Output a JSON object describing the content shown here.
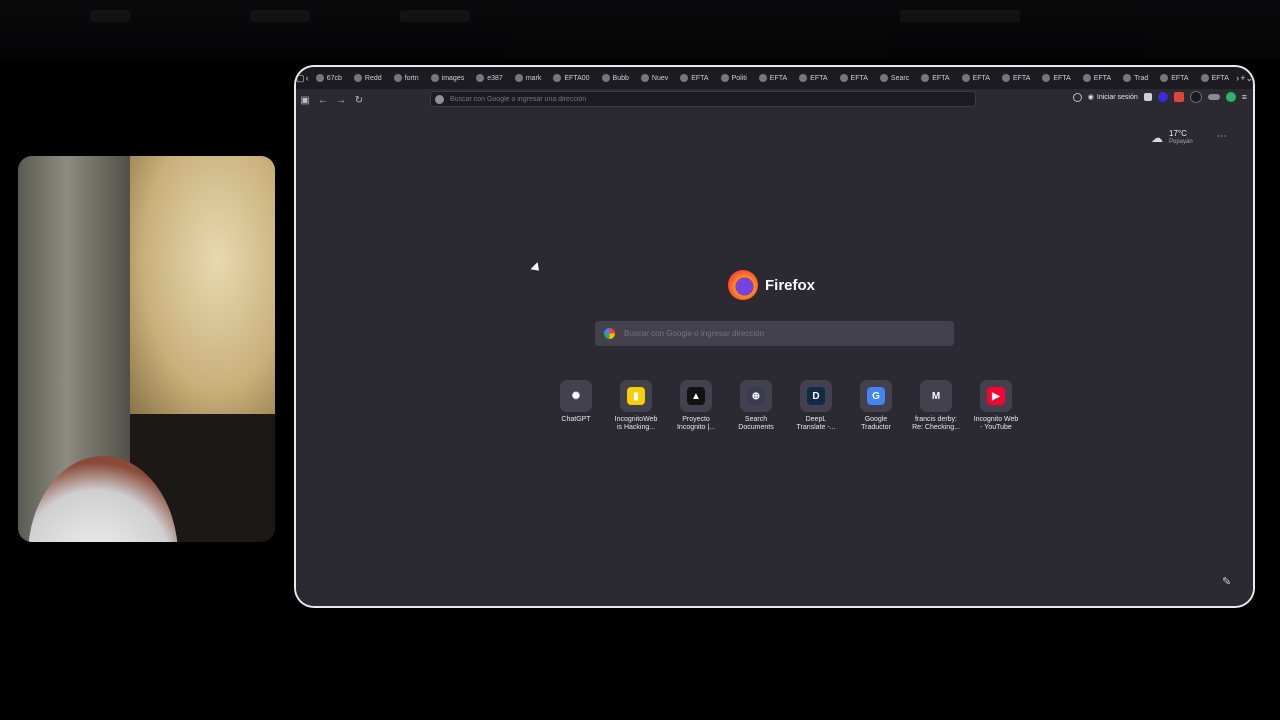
{
  "browser": {
    "tabs": [
      {
        "label": "67cb"
      },
      {
        "label": "Redd"
      },
      {
        "label": "fortn"
      },
      {
        "label": "images"
      },
      {
        "label": "e387"
      },
      {
        "label": "mark"
      },
      {
        "label": "EFTA00"
      },
      {
        "label": "Bubb"
      },
      {
        "label": "Nuev"
      },
      {
        "label": "EFTA"
      },
      {
        "label": "Politi"
      },
      {
        "label": "EFTA"
      },
      {
        "label": "EFTA"
      },
      {
        "label": "EFTA"
      },
      {
        "label": "Searc"
      },
      {
        "label": "EFTA"
      },
      {
        "label": "EFTA"
      },
      {
        "label": "EFTA"
      },
      {
        "label": "EFTA"
      },
      {
        "label": "EFTA"
      },
      {
        "label": "Trad"
      },
      {
        "label": "EFTA"
      },
      {
        "label": "EFTA"
      }
    ],
    "new_tab_symbol": "+",
    "url_placeholder": "Buscar con Google o ingresar una dirección",
    "signin_label": "Iniciar sesión"
  },
  "newtab": {
    "weather": {
      "temp": "17°C",
      "city": "Popayán"
    },
    "logo_text": "Firefox",
    "search_placeholder": "Buscar con Google o ingresar dirección",
    "shortcuts": [
      {
        "line1": "ChatGPT",
        "line2": "",
        "icon": "chatgpt-icon",
        "color": "#42414d",
        "glyph": "✺"
      },
      {
        "line1": "IncognitoWeb",
        "line2": "is Hacking...",
        "icon": "incognitoweb-icon",
        "color": "#f5d000",
        "glyph": "▮"
      },
      {
        "line1": "Proyecto",
        "line2": "Incognito |...",
        "icon": "proyecto-icon",
        "color": "#111111",
        "glyph": "▲"
      },
      {
        "line1": "Search",
        "line2": "Documents",
        "icon": "search-documents-icon",
        "color": "#3b3a52",
        "glyph": "⊕"
      },
      {
        "line1": "DeepL",
        "line2": "Translate -...",
        "icon": "deepl-icon",
        "color": "#0f2b46",
        "glyph": "D"
      },
      {
        "line1": "Google",
        "line2": "Traductor",
        "icon": "google-translate-icon",
        "color": "#4285f4",
        "glyph": "G"
      },
      {
        "line1": "francis derby:",
        "line2": "Re: Checking...",
        "icon": "gmail-icon",
        "color": "#42414d",
        "glyph": "M"
      },
      {
        "line1": "Incognito Web",
        "line2": "- YouTube",
        "icon": "youtube-icon",
        "color": "#ff0033",
        "glyph": "▶"
      }
    ]
  }
}
